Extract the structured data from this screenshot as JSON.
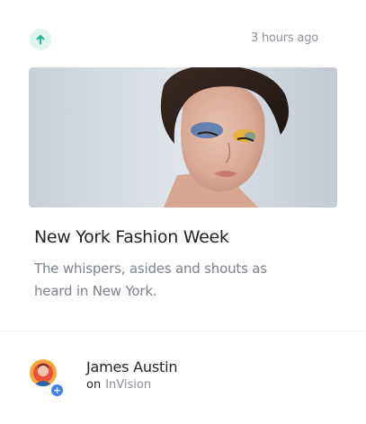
{
  "post": {
    "time_ago": "3 hours ago",
    "title": "New York Fashion Week",
    "description": "The whispers, asides and shouts as heard in New York."
  },
  "author": {
    "name": "James Austin",
    "on_label": "on",
    "source": "InVision"
  },
  "icons": {
    "upvote": "arrow-up-icon",
    "badge": "plus-icon"
  },
  "colors": {
    "accent": "#1abc9c",
    "badge": "#3d7ef0",
    "text_primary": "#232529",
    "text_muted": "#8a8f98"
  }
}
